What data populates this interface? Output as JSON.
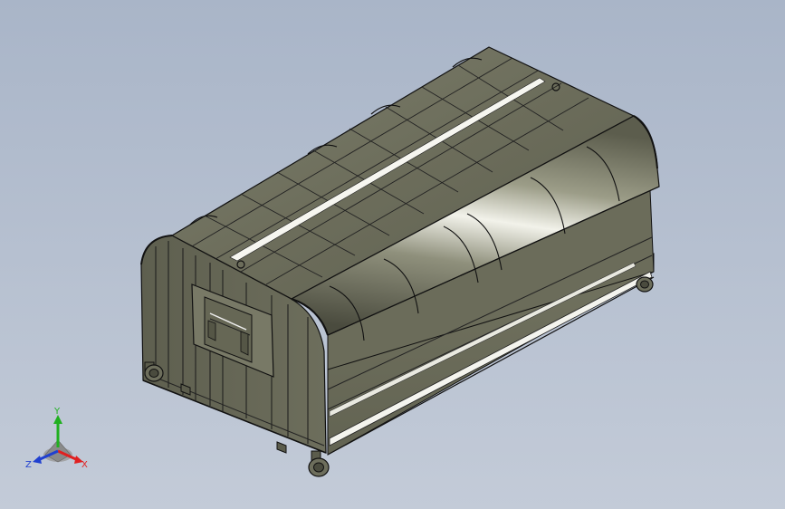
{
  "viewport": {
    "background_top": "#a9b5c8",
    "background_bottom": "#c3cbd8"
  },
  "model": {
    "body_color": "#6f705e",
    "body_dark": "#4e4f42",
    "highlight": "#ffffff",
    "edge_color": "#111111"
  },
  "triad": {
    "x_label": "X",
    "y_label": "Y",
    "z_label": "Z",
    "x_color": "#e02020",
    "y_color": "#20b020",
    "z_color": "#2040d0"
  }
}
